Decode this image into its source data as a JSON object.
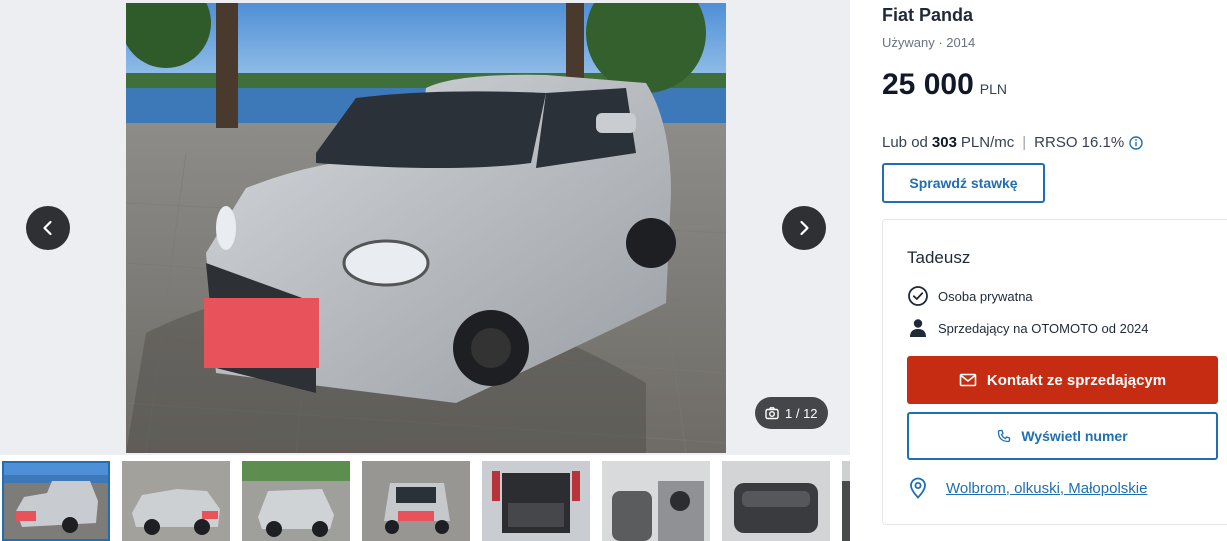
{
  "gallery": {
    "counter": "1 / 12",
    "current_photo": 1,
    "total_photos": 12,
    "thumbnail_count": 8
  },
  "listing": {
    "title": "Fiat Panda",
    "subtitle": "Używany · 2014",
    "price_amount": "25 000",
    "price_currency": "PLN",
    "finance_prefix": "Lub od",
    "finance_amount": "303",
    "finance_unit": "PLN/mc",
    "finance_separator": "|",
    "finance_rrso": "RRSO 16.1%",
    "check_rate_label": "Sprawdź stawkę"
  },
  "seller": {
    "name": "Tadeusz",
    "type_label": "Osoba prywatna",
    "since_label": "Sprzedający na OTOMOTO od 2024",
    "contact_label": "Kontakt ze sprzedającym",
    "phone_label": "Wyświetl numer",
    "location": "Wolbrom, olkuski, Małopolskie"
  },
  "icons": {
    "prev": "chevron-left-icon",
    "next": "chevron-right-icon",
    "camera": "camera-icon",
    "info": "info-icon",
    "verified": "check-circle-icon",
    "user": "user-icon",
    "mail": "mail-icon",
    "phone": "phone-icon",
    "location": "location-pin-icon"
  },
  "colors": {
    "primary_blue": "#1f6fb2",
    "contact_red": "#c52c12",
    "nav_button": "#2f3034"
  }
}
